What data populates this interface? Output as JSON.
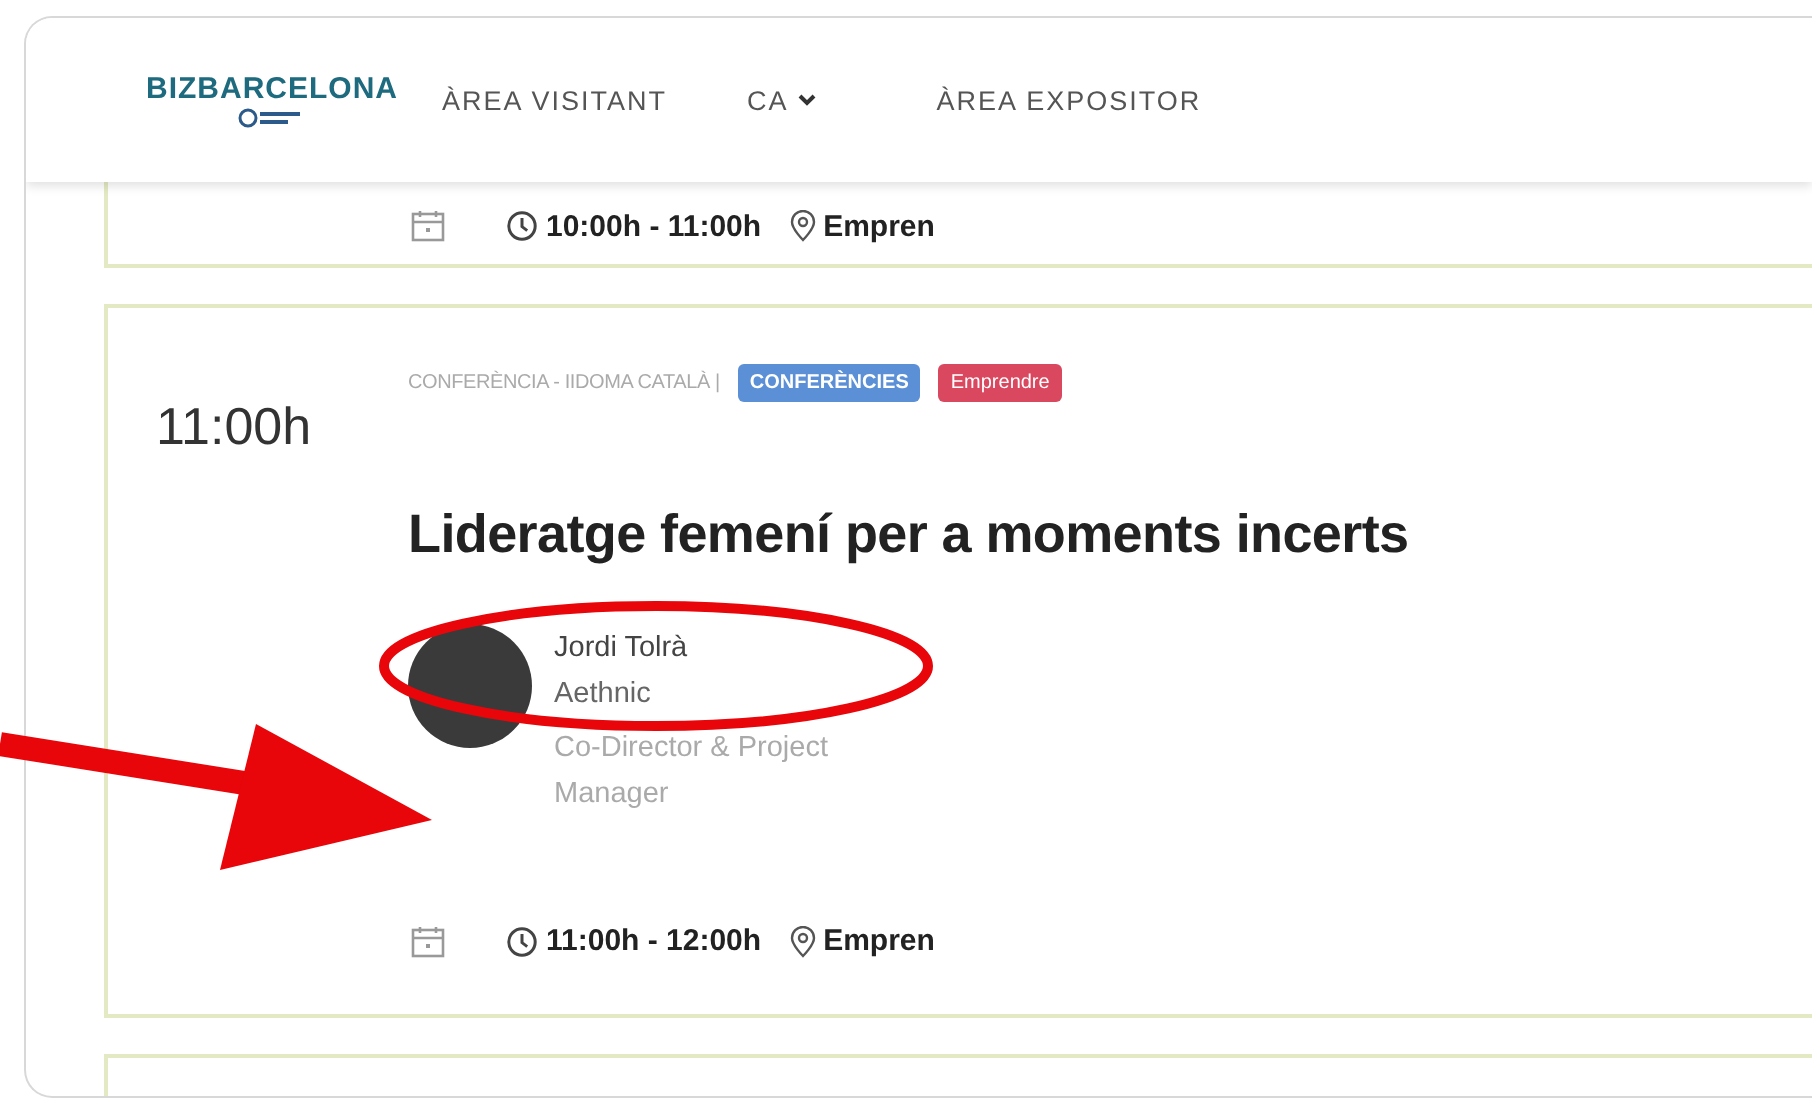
{
  "header": {
    "logo": "BIZBARCELONA",
    "nav": [
      {
        "label": "ÀREA VISITANT",
        "kind": "link"
      },
      {
        "label": "CA",
        "kind": "dropdown"
      },
      {
        "label": "ÀREA EXPOSITOR",
        "kind": "link"
      }
    ]
  },
  "sessions": [
    {
      "time_range": "10:00h - 11:00h",
      "location": "Empren"
    },
    {
      "start": "11:00h",
      "category": "CONFERÈNCIA - IIDOMA CATALÀ |",
      "tags": [
        {
          "label": "CONFERÈNCIES",
          "color": "#5b8fd6"
        },
        {
          "label": "Emprendre",
          "color": "#d9485f"
        }
      ],
      "title": "Lideratge femení per a moments incerts",
      "speaker": {
        "name": "Jordi Tolrà",
        "company": "Aethnic",
        "role_lines": [
          "Co-Director & Project",
          "Manager"
        ]
      },
      "time_range": "11:00h - 12:00h",
      "location": "Empren"
    }
  ]
}
